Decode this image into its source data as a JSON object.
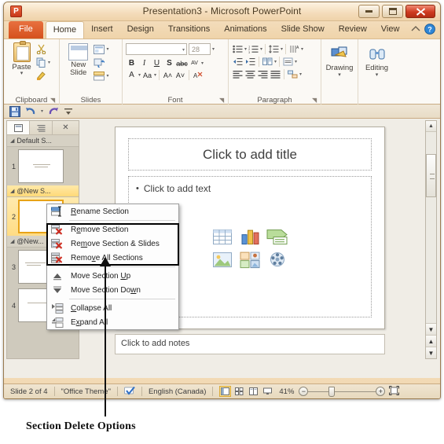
{
  "window": {
    "title": "Presentation3 - Microsoft PowerPoint",
    "app_icon": "P",
    "controls": {
      "minimize": "minimize-icon",
      "maximize": "maximize-icon",
      "close": "close-icon"
    }
  },
  "ribbon": {
    "tabs": [
      {
        "label": "File",
        "active": false,
        "special": true
      },
      {
        "label": "Home",
        "active": true
      },
      {
        "label": "Insert",
        "active": false
      },
      {
        "label": "Design",
        "active": false
      },
      {
        "label": "Transitions",
        "active": false
      },
      {
        "label": "Animations",
        "active": false
      },
      {
        "label": "Slide Show",
        "active": false
      },
      {
        "label": "Review",
        "active": false
      },
      {
        "label": "View",
        "active": false
      }
    ],
    "groups": {
      "clipboard": {
        "label": "Clipboard",
        "paste_label": "Paste",
        "items": [
          "cut-icon",
          "copy-icon",
          "format-painter-icon"
        ]
      },
      "slides": {
        "label": "Slides",
        "new_slide_label": "New Slide",
        "items": [
          "layout-icon",
          "reset-icon",
          "section-icon"
        ]
      },
      "font": {
        "label": "Font",
        "font_name": "",
        "font_size": "28",
        "buttons": [
          "bold-icon",
          "italic-icon",
          "underline-icon",
          "shadow-icon",
          "strikethrough-icon",
          "character-spacing-icon",
          "font-color-icon",
          "change-case-icon",
          "grow-font-icon",
          "shrink-font-icon",
          "clear-formatting-icon"
        ]
      },
      "paragraph": {
        "label": "Paragraph",
        "buttons": [
          "bullets-icon",
          "numbering-icon",
          "line-spacing-icon",
          "text-direction-icon",
          "decrease-indent-icon",
          "increase-indent-icon",
          "columns-icon",
          "align-text-icon",
          "align-left-icon",
          "align-center-icon",
          "align-right-icon",
          "justify-icon",
          "convert-smartart-icon"
        ]
      },
      "drawing": {
        "label": "Drawing",
        "icon": "shapes-icon"
      },
      "editing": {
        "label": "Editing",
        "icon": "binoculars-icon"
      }
    },
    "help_icon": "help-icon",
    "minimize_ribbon_icon": "minimize-ribbon-icon"
  },
  "quick_access": {
    "items": [
      "save-icon",
      "undo-icon",
      "redo-icon",
      "customize-icon"
    ]
  },
  "slide_panel": {
    "tabs": [
      {
        "label": "slides-tab-icon",
        "active": true
      },
      {
        "label": "outline-tab-icon",
        "active": false
      }
    ],
    "close_icon": "close-icon",
    "sections": [
      {
        "name": "Default S...",
        "selected": false,
        "slides": [
          {
            "number": "1",
            "selected": false
          }
        ]
      },
      {
        "name": "@New S...",
        "selected": true,
        "slides": [
          {
            "number": "2",
            "selected": true
          }
        ]
      },
      {
        "name": "@New...",
        "selected": false,
        "slides": [
          {
            "number": "3",
            "selected": false
          },
          {
            "number": "4",
            "selected": false
          }
        ]
      }
    ]
  },
  "slide": {
    "title_placeholder": "Click to add title",
    "body_placeholder": "Click to add text",
    "content_icons": [
      "table-icon",
      "chart-icon",
      "smartart-icon",
      "picture-icon",
      "clipart-icon",
      "media-icon"
    ]
  },
  "notes": {
    "placeholder": "Click to add notes"
  },
  "context_menu": {
    "items": [
      {
        "id": "rename-section",
        "label": "Rename Section",
        "accel": "R",
        "icon": "rename-section-icon",
        "highlighted": false
      },
      {
        "id": "remove-section",
        "label": "Remove Section",
        "accel": "R",
        "icon": "remove-section-icon",
        "highlighted": true
      },
      {
        "id": "remove-section-slides",
        "label": "Remove Section & Slides",
        "accel": "m",
        "icon": "remove-section-slides-icon",
        "highlighted": true
      },
      {
        "id": "remove-all-sections",
        "label": "Remove All Sections",
        "accel": "v",
        "icon": "remove-all-sections-icon",
        "highlighted": true
      },
      {
        "id": "move-section-up",
        "label": "Move Section Up",
        "accel": "U",
        "icon": "move-up-icon",
        "highlighted": false
      },
      {
        "id": "move-section-down",
        "label": "Move Section Down",
        "accel": "w",
        "icon": "move-down-icon",
        "highlighted": false
      },
      {
        "id": "collapse-all",
        "label": "Collapse All",
        "accel": "C",
        "icon": "collapse-all-icon",
        "highlighted": false
      },
      {
        "id": "expand-all",
        "label": "Expand All",
        "accel": "x",
        "icon": "expand-all-icon",
        "highlighted": false
      }
    ]
  },
  "status_bar": {
    "slide_count": "Slide 2 of 4",
    "theme": "\"Office Theme\"",
    "spellcheck_icon": "spellcheck-icon",
    "language": "English (Canada)",
    "views": [
      {
        "name": "normal-view-button",
        "active": true
      },
      {
        "name": "slide-sorter-button",
        "active": false
      },
      {
        "name": "reading-view-button",
        "active": false
      },
      {
        "name": "slide-show-button",
        "active": false
      }
    ],
    "zoom_level": "41%",
    "zoom_out_label": "−",
    "zoom_in_label": "+",
    "fit_window_icon": "fit-to-window-icon"
  },
  "annotation": {
    "label": "Section Delete Options"
  }
}
